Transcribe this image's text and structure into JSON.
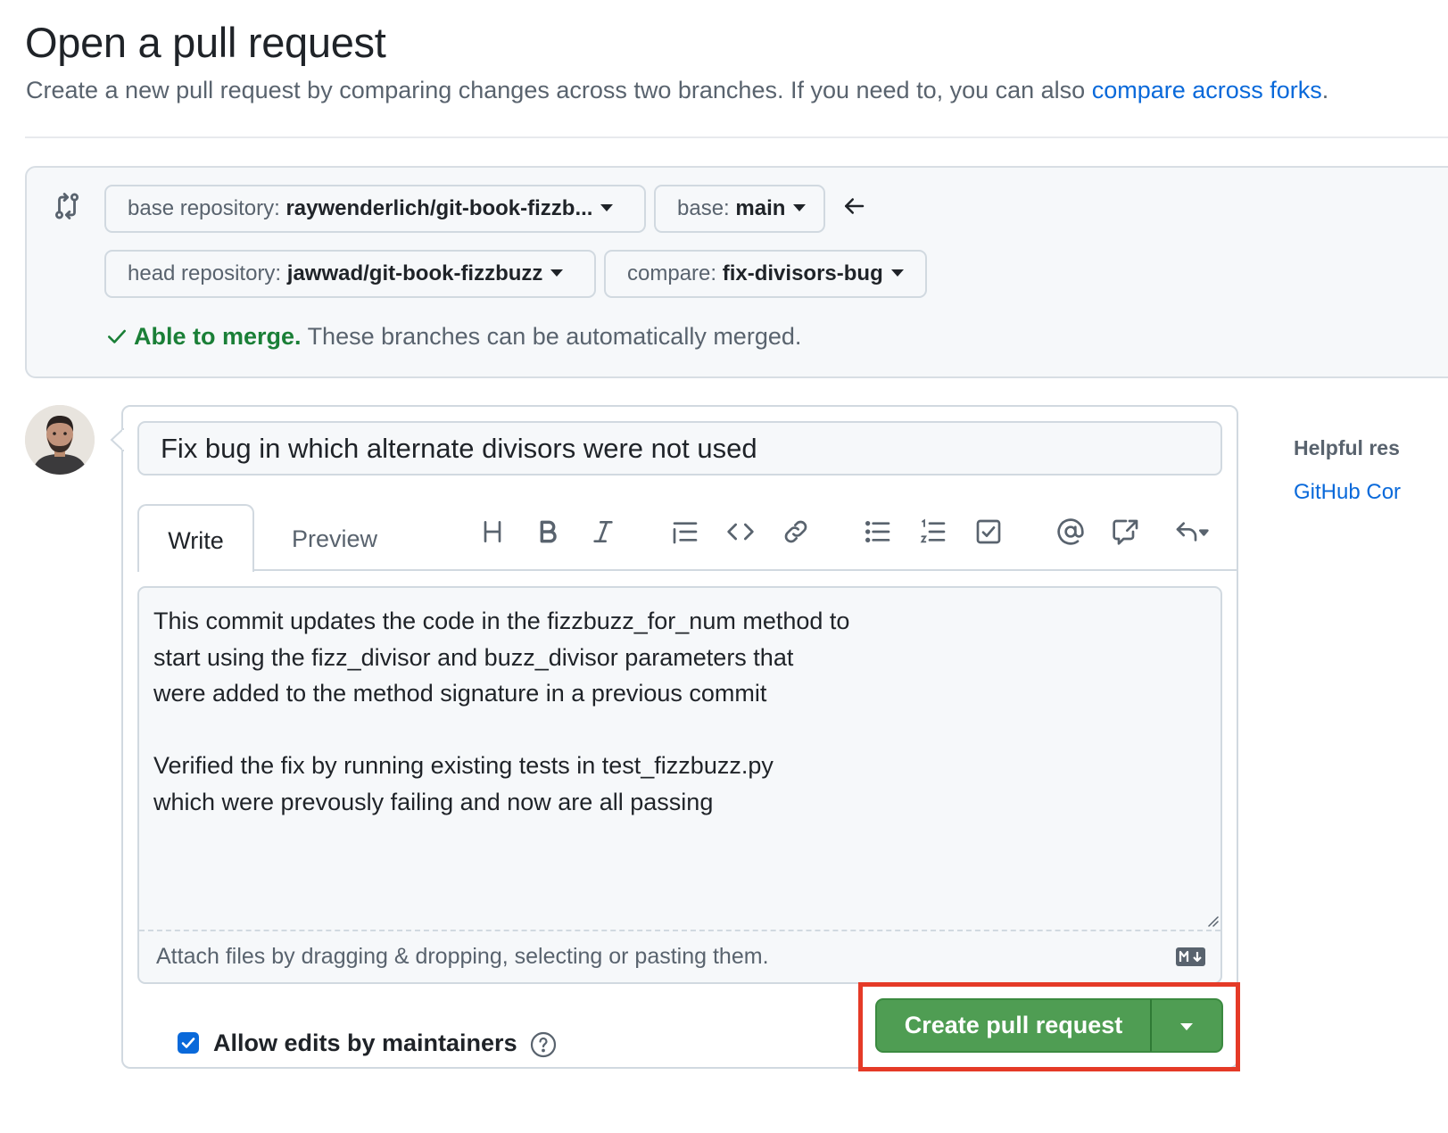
{
  "header": {
    "title": "Open a pull request",
    "subtitle": "Create a new pull request by comparing changes across two branches. If you need to, you can also",
    "subtitle_link": "compare across forks",
    "subtitle_end": "."
  },
  "compare": {
    "icon": "git-compare-icon",
    "base_repo_label": "base repository:",
    "base_repo_value": "raywenderlich/git-book-fizzb...",
    "base_label": "base:",
    "base_value": "main",
    "head_repo_label": "head repository:",
    "head_repo_value": "jawwad/git-book-fizzbuzz",
    "compare_label": "compare:",
    "compare_value": "fix-divisors-bug",
    "merge_ok": "Able to merge.",
    "merge_text": "These branches can be automatically merged."
  },
  "form": {
    "title_value": "Fix bug in which alternate divisors were not used",
    "tabs": [
      "Write",
      "Preview"
    ],
    "toolbar_icons": [
      "heading-icon",
      "bold-icon",
      "italic-icon",
      "quote-icon",
      "code-icon",
      "link-icon",
      "unordered-list-icon",
      "ordered-list-icon",
      "tasklist-icon",
      "mention-icon",
      "cross-reference-icon",
      "reply-icon"
    ],
    "body_value": "This commit updates the code in the fizzbuzz_for_num method to\nstart using the fizz_divisor and buzz_divisor parameters that\nwere added to the method signature in a previous commit\n\nVerified the fix by running existing tests in test_fizzbuzz.py\nwhich were prevously failing and now are all passing",
    "attach_text": "Attach files by dragging & dropping, selecting or pasting them.",
    "allow_edits_label": "Allow edits by maintainers",
    "allow_edits_checked": true,
    "submit_label": "Create pull request"
  },
  "sidebar": {
    "heading": "Helpful res",
    "link": "GitHub Cor"
  },
  "colors": {
    "accent_blue": "#0969da",
    "success_green": "#1a7f37",
    "button_green": "#4f9d53",
    "highlight_red": "#e53a27"
  }
}
